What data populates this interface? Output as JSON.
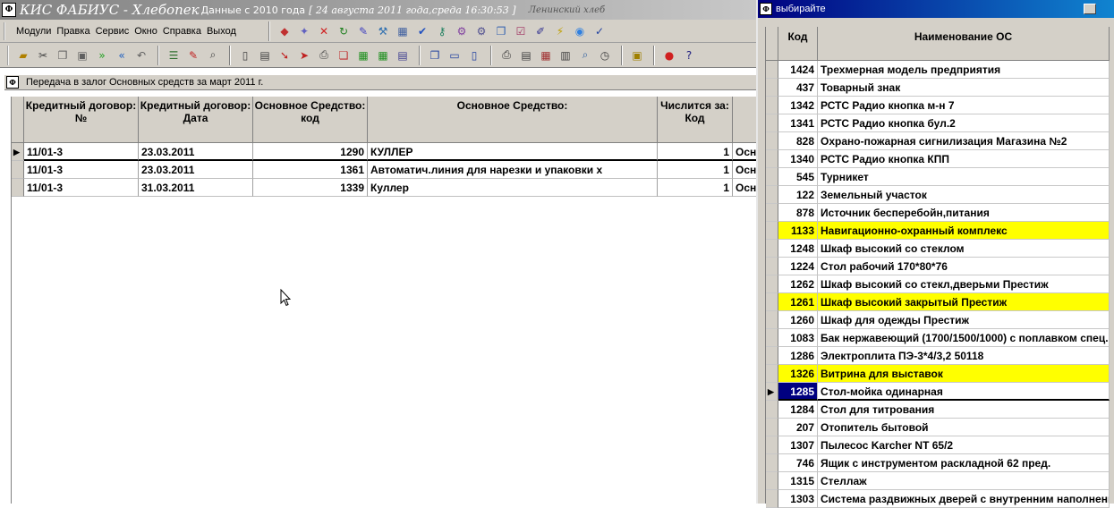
{
  "main_window": {
    "app_title": "КИС ФАБИУС - Хлебопек",
    "data_since": "Данные с 2010 года",
    "date_info": "[ 24 августа 2011 года,среда  16:30:53 ]",
    "company": "Ленинский хлеб"
  },
  "menu": [
    "Модули",
    "Правка",
    "Сервис",
    "Окно",
    "Справка",
    "Выход"
  ],
  "toolbar": {
    "row1_icons": [
      "eraser-icon",
      "magic-wand-icon",
      "delete-x-icon",
      "refresh-icon",
      "pin-icon",
      "wrench-icon",
      "calculator-icon",
      "check-icon",
      "key-icon",
      "tools-icon",
      "settings-icon",
      "copy-window-icon",
      "checklist-icon",
      "paint-icon",
      "lightning-icon",
      "globe-icon",
      "spell-check-icon"
    ],
    "row2_icons": [
      "open-folder-icon",
      "cut-icon",
      "copy-icon",
      "paste-icon",
      "next-icon",
      "prev-icon",
      "undo-icon",
      "list-icon",
      "pencil-icon",
      "search-doc-icon",
      "new-doc-icon",
      "doc-icon",
      "arrow-icon",
      "export-icon",
      "print-preview-icon",
      "copy-doc-icon",
      "excel-icon",
      "excel2-icon",
      "dbf-icon",
      "windows-icon",
      "split-h-icon",
      "split-v-icon",
      "printer-icon",
      "report-icon",
      "table-icon",
      "calculator2-icon",
      "find-icon",
      "clock-icon",
      "cabinet-icon",
      "balloon-icon",
      "help-icon"
    ]
  },
  "document": {
    "title": "Передача в залог Основных средств за март 2011 г.",
    "columns": [
      "Кредитный договор: №",
      "Кредитный договор: Дата",
      "Основное Средство: код",
      "Основное Средство:",
      "Числится за: Код",
      ""
    ],
    "rows": [
      {
        "num": "11/01-3",
        "date": "23.03.2011",
        "code": "1290",
        "name": "КУЛЛЕР",
        "owner": "1",
        "extra": "Осн"
      },
      {
        "num": "11/01-3",
        "date": "23.03.2011",
        "code": "1361",
        "name": "Автоматич.линия для нарезки и упаковки х",
        "owner": "1",
        "extra": "Осн"
      },
      {
        "num": "11/01-3",
        "date": "31.03.2011",
        "code": "1339",
        "name": "Куллер",
        "owner": "1",
        "extra": "Осн"
      }
    ]
  },
  "picker": {
    "title": "выбирайте",
    "col_code": "Код",
    "col_name": "Наименование ОС",
    "rows": [
      {
        "code": "1424",
        "name": "Трехмерная модель предприятия",
        "state": ""
      },
      {
        "code": "437",
        "name": "Товарный знак",
        "state": ""
      },
      {
        "code": "1342",
        "name": "РСТС Радио кнопка м-н 7",
        "state": ""
      },
      {
        "code": "1341",
        "name": "РСТС Радио кнопка бул.2",
        "state": ""
      },
      {
        "code": "828",
        "name": "Охрано-пожарная сигнилизация Магазина №2",
        "state": ""
      },
      {
        "code": "1340",
        "name": "РСТС Радио кнопка КПП",
        "state": ""
      },
      {
        "code": "545",
        "name": "Турникет",
        "state": ""
      },
      {
        "code": "122",
        "name": "Земельный участок",
        "state": ""
      },
      {
        "code": "878",
        "name": "Источник бесперебойн,питания",
        "state": ""
      },
      {
        "code": "1133",
        "name": "Навигационно-охранный комплекс",
        "state": "highlight"
      },
      {
        "code": "1248",
        "name": "Шкаф высокий со стеклом",
        "state": ""
      },
      {
        "code": "1224",
        "name": "Стол рабочий 170*80*76",
        "state": ""
      },
      {
        "code": "1262",
        "name": "Шкаф высокий со стекл,дверьми Престиж",
        "state": ""
      },
      {
        "code": "1261",
        "name": "Шкаф высокий закрытый Престиж",
        "state": "highlight"
      },
      {
        "code": "1260",
        "name": "Шкаф для одежды Престиж",
        "state": ""
      },
      {
        "code": "1083",
        "name": "Бак нержавеющий (1700/1500/1000) с поплавком спец.",
        "state": ""
      },
      {
        "code": "1286",
        "name": "Электроплита ПЭ-3*4/3,2 50118",
        "state": ""
      },
      {
        "code": "1326",
        "name": "Витрина для выставок",
        "state": "highlight"
      },
      {
        "code": "1285",
        "name": "Стол-мойка одинарная",
        "state": "selected"
      },
      {
        "code": "1284",
        "name": "Стол для титрования",
        "state": ""
      },
      {
        "code": "207",
        "name": "Отопитель бытовой",
        "state": ""
      },
      {
        "code": "1307",
        "name": "Пылесос Karcher NT 65/2",
        "state": ""
      },
      {
        "code": "746",
        "name": "Ящик с инструментом раскладной 62 пред.",
        "state": ""
      },
      {
        "code": "1315",
        "name": "Стеллаж",
        "state": ""
      },
      {
        "code": "1303",
        "name": "Система раздвижных дверей с внутренним наполнени",
        "state": ""
      }
    ]
  },
  "colors": {
    "highlight": "#ffff00",
    "selected": "#000080",
    "chrome": "#d4d0c8"
  }
}
